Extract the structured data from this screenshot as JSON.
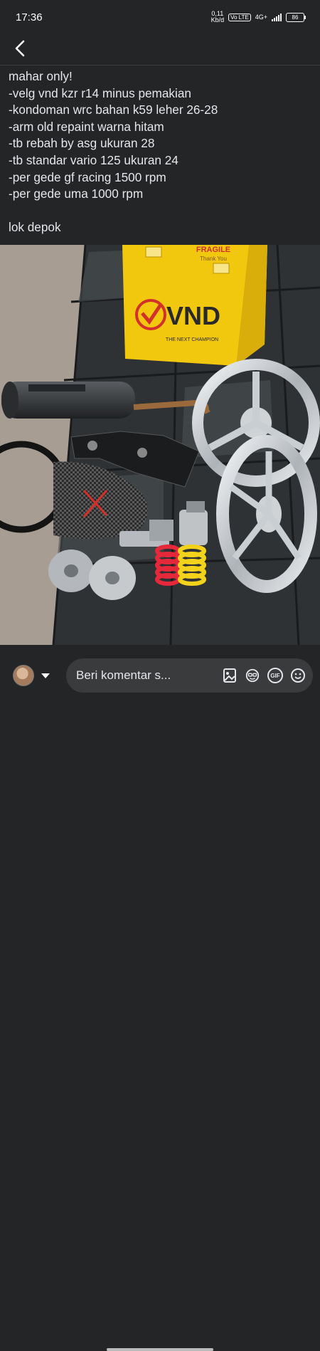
{
  "status_bar": {
    "time": "17:36",
    "net_speed_top": "0,11",
    "net_speed_bottom": "Kb/d",
    "volte": "Vo LTE",
    "network": "4G+",
    "battery": "86"
  },
  "caption": {
    "lines": [
      "mahar only!",
      "-velg vnd kzr r14 minus pemakian",
      "-kondoman wrc bahan k59 leher 26-28",
      "-arm old repaint warna hitam",
      "-tb rebah by asg ukuran 28",
      "-tb standar vario 125 ukuran 24",
      "-per gede gf racing 1500 rpm",
      "-per gede uma 1000 rpm",
      "",
      "lok depok"
    ]
  },
  "photo": {
    "box_label_top": "FRAGILE",
    "box_label_sub": "Thank You",
    "box_brand": "VND",
    "box_tagline": "THE NEXT CHAMPION"
  },
  "comment_bar": {
    "placeholder": "Beri komentar s...",
    "gif_label": "GIF"
  },
  "colors": {
    "background": "#242526",
    "input_bg": "#3a3b3c",
    "box_yellow": "#f2c80f",
    "brand_red": "#d3302a"
  }
}
